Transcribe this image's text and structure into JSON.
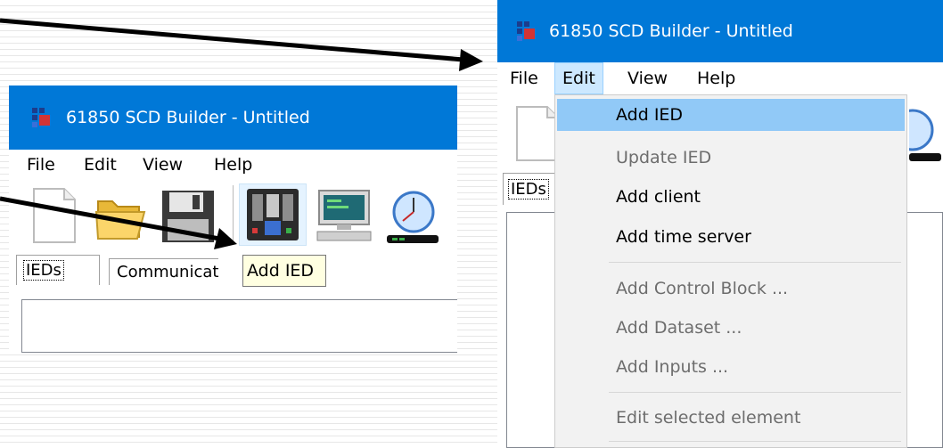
{
  "left_window": {
    "title": "61850 SCD Builder - Untitled",
    "menu": [
      "File",
      "Edit",
      "View",
      "Help"
    ],
    "toolbar_icons": [
      "new-file-icon",
      "open-folder-icon",
      "save-disk-icon",
      "ied-device-icon",
      "client-computer-icon",
      "time-server-icon"
    ],
    "tabs": [
      "IEDs",
      "Communicat"
    ],
    "tooltip": "Add IED"
  },
  "right_window": {
    "title": "61850 SCD Builder - Untitled",
    "menu": [
      "File",
      "Edit",
      "View",
      "Help"
    ],
    "active_menu": "Edit",
    "tabs": [
      "IEDs"
    ],
    "edit_menu": {
      "items": [
        {
          "label": "Add IED",
          "state": "highlighted"
        },
        {
          "label": "Update IED",
          "state": "disabled"
        },
        {
          "label": "Add client",
          "state": "enabled"
        },
        {
          "label": "Add time server",
          "state": "enabled"
        },
        {
          "label": "Add Control Block ...",
          "state": "disabled"
        },
        {
          "label": "Add Dataset ...",
          "state": "disabled"
        },
        {
          "label": "Add Inputs ...",
          "state": "disabled"
        },
        {
          "label": "Edit selected element",
          "state": "disabled"
        }
      ]
    }
  },
  "colors": {
    "titlebar": "#0078d7",
    "menu_highlight": "#91c9f7",
    "tooltip_bg": "#ffffe1",
    "disabled_text": "#6d6d6d"
  }
}
